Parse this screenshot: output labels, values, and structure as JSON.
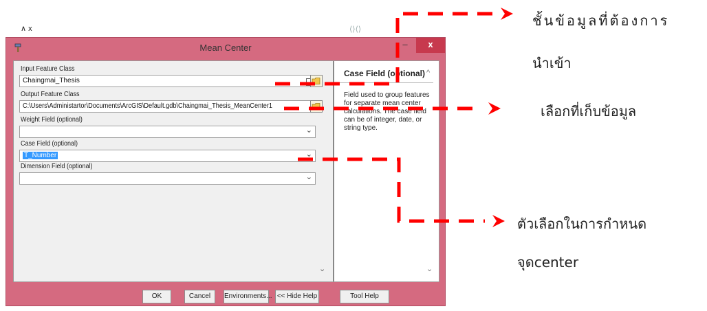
{
  "background": {
    "fragment_left": "∧ x",
    "fragment_right": "⟨⟩⟨⟩"
  },
  "window": {
    "title": "Mean Center",
    "icons": {
      "app": "hammer-icon",
      "minimize": "minimize-icon",
      "close": "close-icon"
    },
    "minimize_label": "–",
    "close_label": "x"
  },
  "form": {
    "input_feature_class": {
      "label": "Input Feature Class",
      "value": "Chaingmai_Thesis"
    },
    "output_feature_class": {
      "label": "Output Feature Class",
      "value": "C:\\Users\\Administartor\\Documents\\ArcGIS\\Default.gdb\\Chaingmai_Thesis_MeanCenter1"
    },
    "weight_field": {
      "label": "Weight Field (optional)",
      "value": ""
    },
    "case_field": {
      "label": "Case Field (optional)",
      "value": "T_Number"
    },
    "dimension_field": {
      "label": "Dimension Field (optional)",
      "value": ""
    }
  },
  "help": {
    "title": "Case Field (optional)",
    "text": "Field used to group features for separate mean center calculations. The case field can be of integer, date, or string type."
  },
  "buttons": {
    "ok": "OK",
    "cancel": "Cancel",
    "environments": "Environments...",
    "hide_help": "<< Hide Help",
    "tool_help": "Tool Help"
  },
  "annotations": {
    "input_line1": "ชั้นข้อมูลที่ต้องการ",
    "input_line2": "นำเข้า",
    "output": "เลือกที่เก็บข้อมูล",
    "case_line1": "ตัวเลือกในการกำหนด",
    "case_line2": "จุดcenter"
  },
  "colors": {
    "annotation_red": "#ff0000",
    "window_frame": "#d56a80",
    "close_button": "#c7394e",
    "selection": "#3399ff"
  }
}
